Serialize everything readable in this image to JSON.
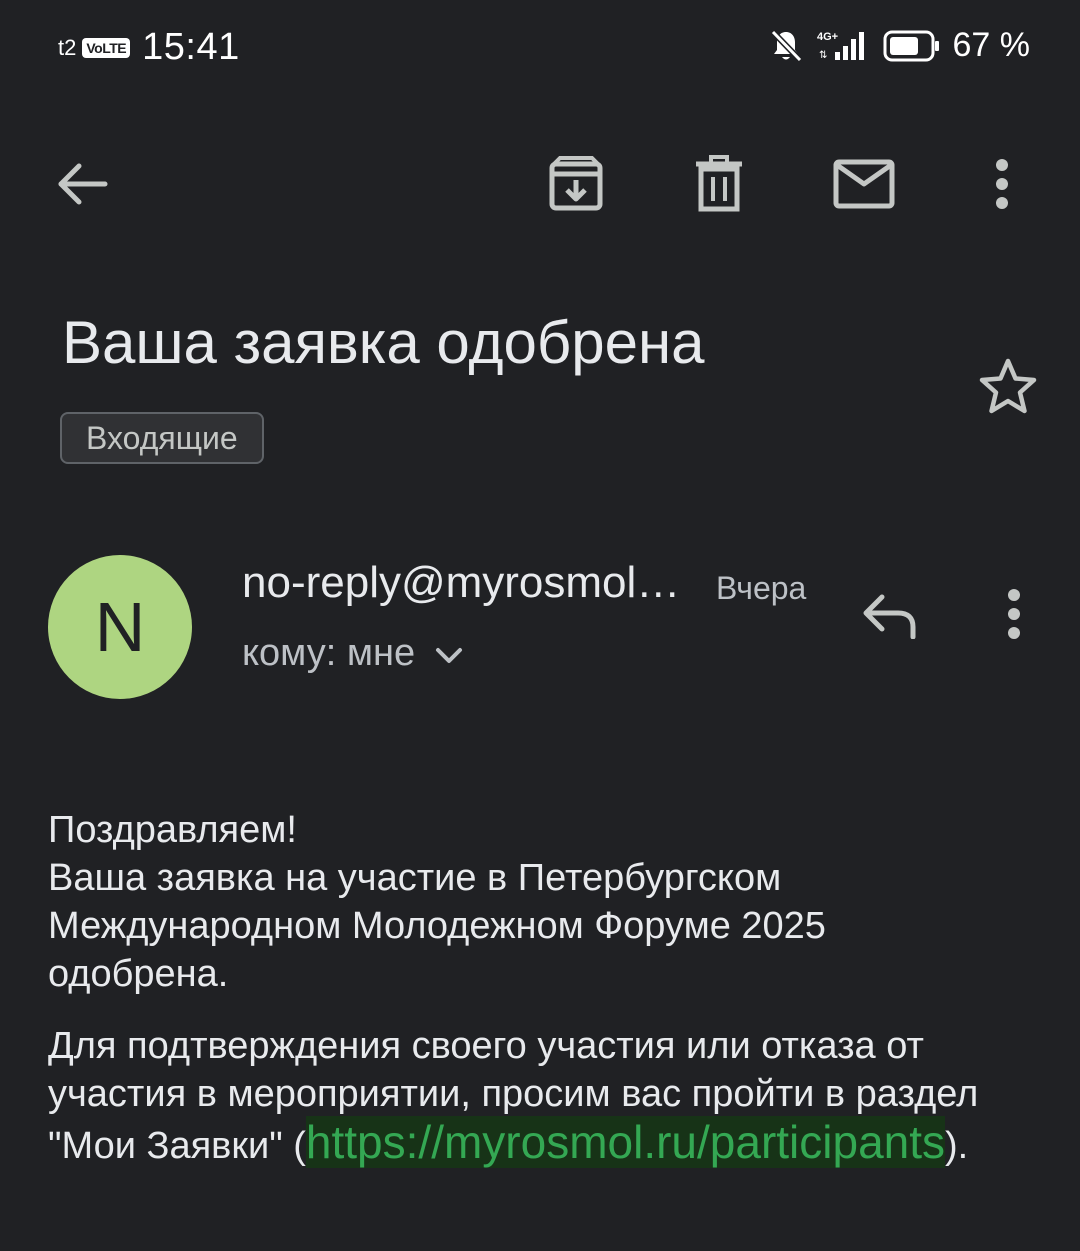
{
  "status_bar": {
    "carrier": "t2",
    "volte": "VoLTE",
    "time": "15:41",
    "network": "4G+",
    "battery": "67 %"
  },
  "toolbar": {
    "back_icon": "arrow-back-icon",
    "archive_icon": "archive-icon",
    "delete_icon": "trash-icon",
    "unread_icon": "mail-icon",
    "more_icon": "more-vert-icon"
  },
  "email": {
    "subject": "Ваша заявка одобрена",
    "label": "Входящие",
    "sender": {
      "initial": "N",
      "name": "no-reply@myrosmol…",
      "date": "Вчера",
      "recipient": "кому: мне",
      "avatar_color": "#aed581"
    },
    "body": {
      "line1": "Поздравляем!",
      "line2": "Ваша заявка на участие в Петербургском Международном Молодежном Форуме 2025 одобрена.",
      "para2_before": "Для подтверждения своего участия или отказа от участия в мероприятии, просим вас пройти в раздел \"Мои Заявки\" (",
      "link": "https://myrosmol.ru/participants",
      "para2_after": ")."
    }
  },
  "colors": {
    "background": "#202124",
    "link": "#34a853",
    "link_bg": "#173317"
  }
}
